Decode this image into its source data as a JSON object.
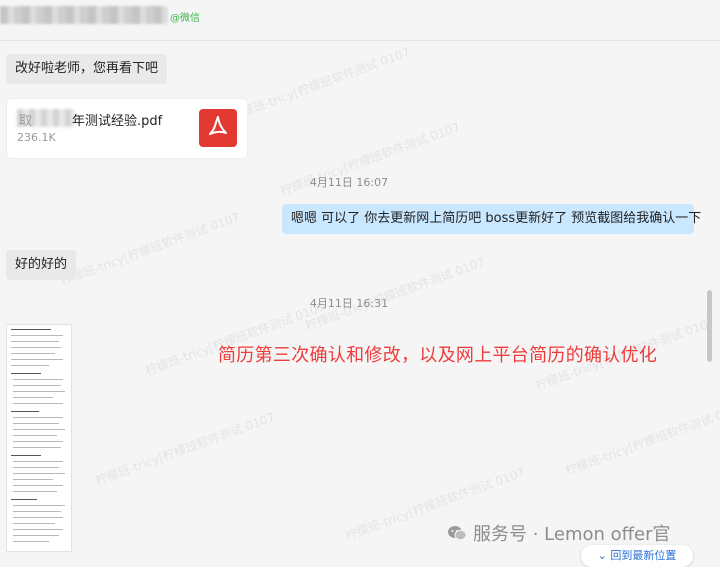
{
  "header": {
    "tag_text": "@微信"
  },
  "messages": {
    "msg1": "改好啦老师，您再看下吧",
    "file": {
      "name_visible": "年测试经验.pdf",
      "name_prefix": "取",
      "size": "236.1K",
      "icon": "pdf-icon"
    },
    "time1": "4月11日 16:07",
    "msg2": "嗯嗯 可以了  你去更新网上简历吧  boss更新好了 预览截图给我确认一下",
    "msg3": "好的好的",
    "time2": "4月11日 16:31"
  },
  "annotation": "简历第三次确认和修改，以及网上平台简历的确认优化",
  "watermark_text": "柠檬班-tricy[柠檬班软件测试 0107",
  "footer": {
    "brand": "服务号 · Lemon offer官",
    "back_button": "回到最新位置"
  },
  "colors": {
    "accent_red": "#ee3b3b",
    "self_bubble": "#c9e7ff",
    "other_bubble": "#e9e9e9",
    "wechat_green": "#39b54a"
  }
}
